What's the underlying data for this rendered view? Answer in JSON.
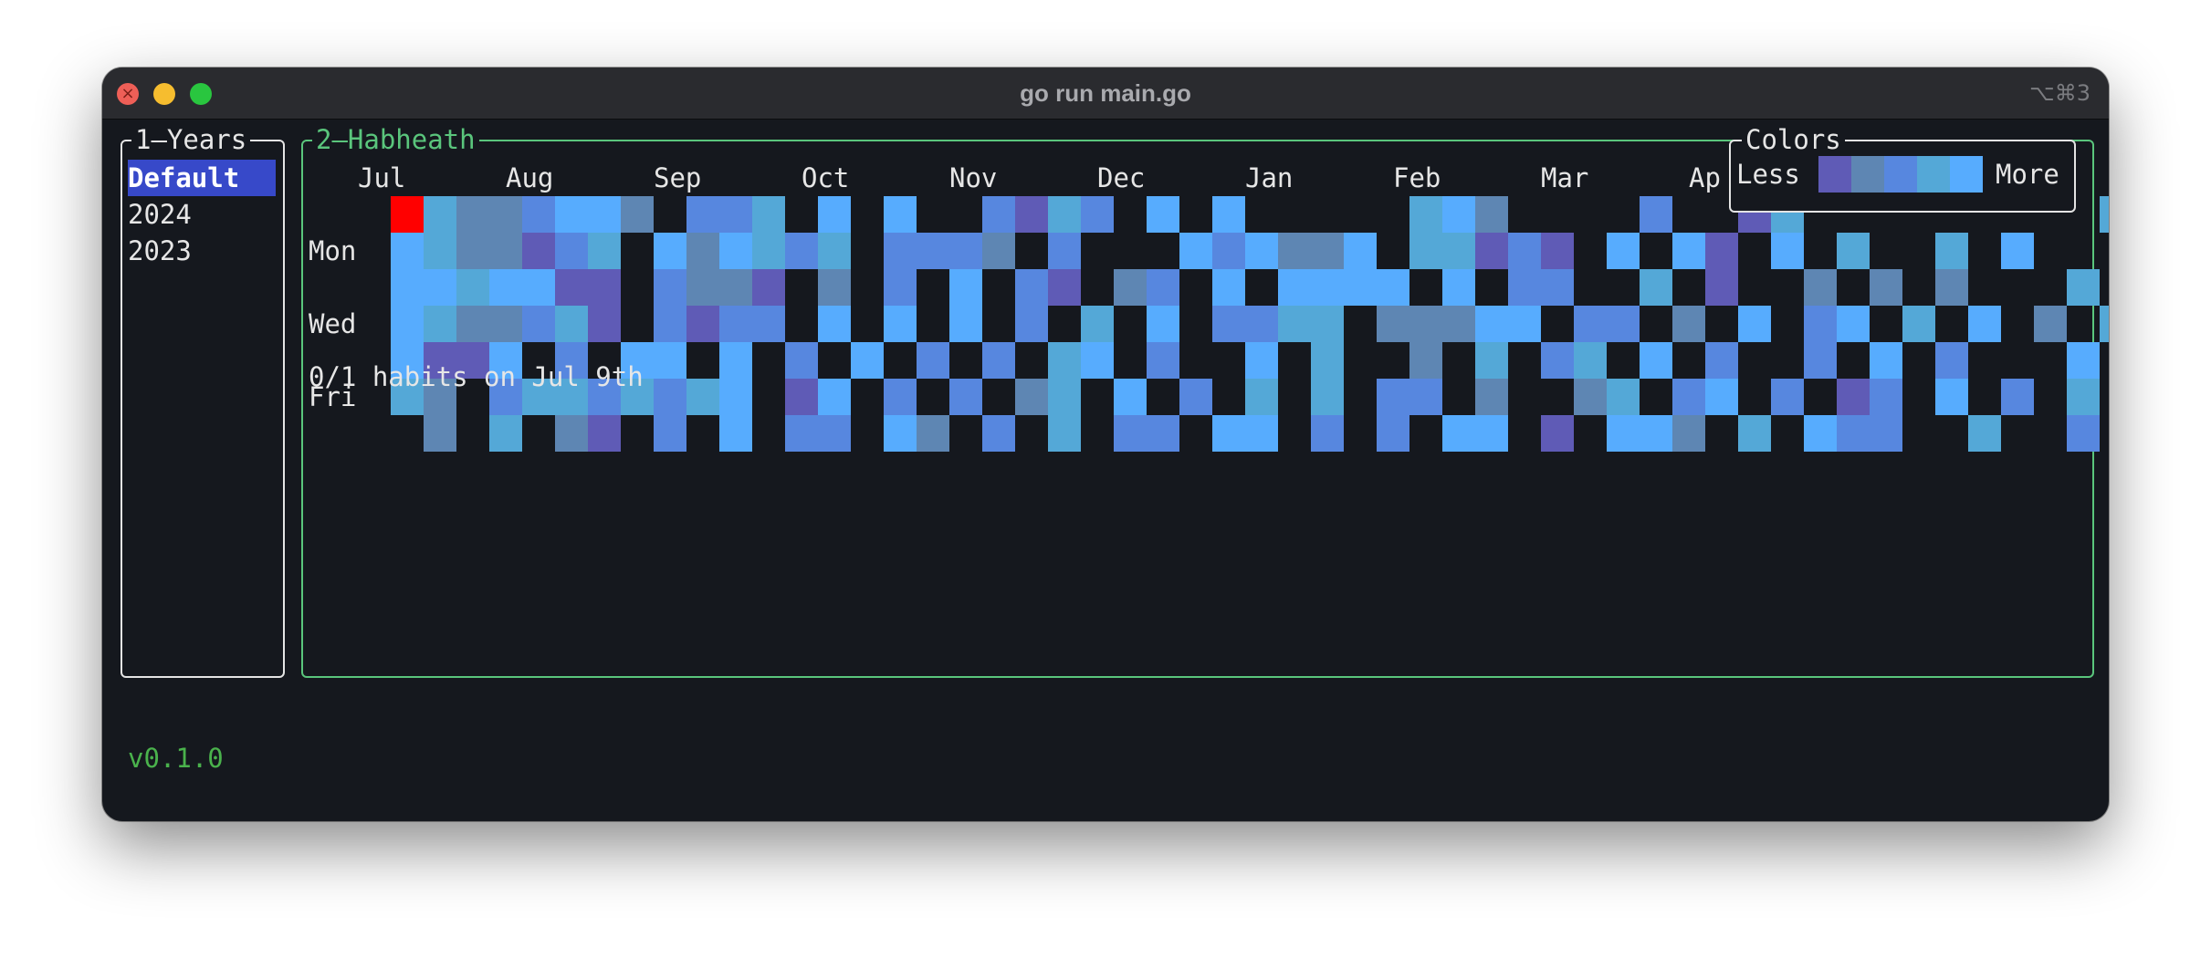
{
  "window": {
    "title": "go run main.go",
    "shortcut": "⌥⌘3"
  },
  "years_panel": {
    "title": "1—Years",
    "items": [
      "Default",
      "2024",
      "2023"
    ],
    "selected_index": 0
  },
  "habit_panel": {
    "title": "2—Habheath",
    "status": "0/1 habits on Jul 9th"
  },
  "colors_panel": {
    "title": "Colors",
    "less_label": "Less",
    "more_label": "More",
    "swatches": [
      "#5f5bb6",
      "#5e86b3",
      "#5787df",
      "#54a8d7",
      "#57acfe"
    ]
  },
  "heatmap": {
    "months": [
      "Jul",
      "Aug",
      "Sep",
      "Oct",
      "Nov",
      "Dec",
      "Jan",
      "Feb",
      "Mar",
      "Ap"
    ],
    "day_labels": [
      "Mon",
      "Wed",
      "Fri"
    ],
    "empty_color": "#15181e",
    "selected_color": "#ff0000",
    "rows": [
      "X3112441 223 4 4  2032 4 4     341    2  03         3",
      "4311023 414323 2221 2   424114 33020 4 40 4 3  3 4   ",
      "4434400 2110 1 2 4 20 12 4 4444 4 22  3 0  1 1 1   3 ",
      "4311230 2022 4 4 4 2 3 4 2233 11144 22 1 4 24 3 4 1 3",
      "4004 2 44 4 2 4 2 2 34 2  4 3  1 3 23 4 2  2 4 2   4 ",
      "31 23323234 04 2 2 13 4 2 3 3 22 1  13 24 2 02 4 2 3 ",
      " 1 3 10 2 4 22 41 2 3 22 44 2 2 44 0 441 3 422  3  2 "
    ]
  },
  "status_bar": {
    "version": "v0.1.0"
  }
}
